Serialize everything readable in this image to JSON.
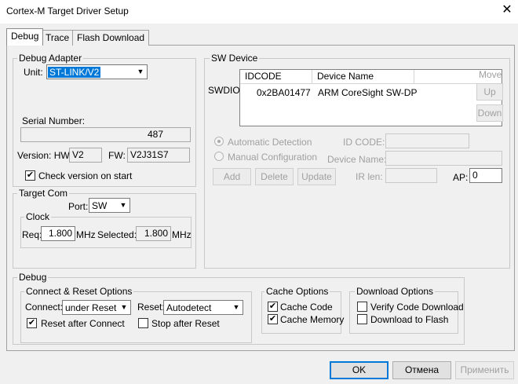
{
  "window": {
    "title": "Cortex-M Target Driver Setup",
    "close_glyph": "✕"
  },
  "tabs": [
    {
      "label": "Debug"
    },
    {
      "label": "Trace"
    },
    {
      "label": "Flash Download"
    }
  ],
  "debug_adapter": {
    "title": "Debug Adapter",
    "unit_label": "Unit:",
    "unit_value": "ST-LINK/V2",
    "serial_label": "Serial Number:",
    "serial_value": "487",
    "version_label": "Version: HW:",
    "hw_value": "V2",
    "fw_label": "FW:",
    "fw_value": "V2J31S7",
    "check_version_label": "Check version on start",
    "check_version_checked": true
  },
  "target_com": {
    "title": "Target Com",
    "port_label": "Port:",
    "port_value": "SW",
    "clock_title": "Clock",
    "req_label": "Req:",
    "req_value": "1.800",
    "req_unit": "MHz",
    "selected_label": "Selected:",
    "selected_value": "1.800",
    "selected_unit": "MHz"
  },
  "sw_device": {
    "title": "SW Device",
    "row_label": "SWDIO",
    "columns": [
      "IDCODE",
      "Device Name"
    ],
    "rows": [
      {
        "idcode": "0x2BA01477",
        "device_name": "ARM CoreSight SW-DP"
      }
    ],
    "move_label": "Move",
    "up_label": "Up",
    "down_label": "Down",
    "auto_detect_label": "Automatic Detection",
    "manual_config_label": "Manual Configuration",
    "id_code_label": "ID CODE:",
    "device_name_label": "Device Name:",
    "ir_len_label": "IR len:",
    "ap_label": "AP:",
    "ap_value": "0",
    "add_label": "Add",
    "delete_label": "Delete",
    "update_label": "Update"
  },
  "debug": {
    "title": "Debug",
    "connect_reset": {
      "title": "Connect & Reset Options",
      "connect_label": "Connect:",
      "connect_value": "under Reset",
      "reset_label": "Reset:",
      "reset_value": "Autodetect",
      "reset_after_connect_label": "Reset after Connect",
      "reset_after_connect_checked": true,
      "stop_after_reset_label": "Stop after Reset",
      "stop_after_reset_checked": false
    },
    "cache": {
      "title": "Cache Options",
      "cache_code_label": "Cache Code",
      "cache_code_checked": true,
      "cache_memory_label": "Cache Memory",
      "cache_memory_checked": true
    },
    "download": {
      "title": "Download Options",
      "verify_label": "Verify Code Download",
      "verify_checked": false,
      "download_flash_label": "Download to Flash",
      "download_flash_checked": false
    }
  },
  "buttons": {
    "ok": "OK",
    "cancel": "Отмена",
    "apply": "Применить"
  },
  "icons": {
    "check": "✔",
    "dropdown": "▼"
  }
}
